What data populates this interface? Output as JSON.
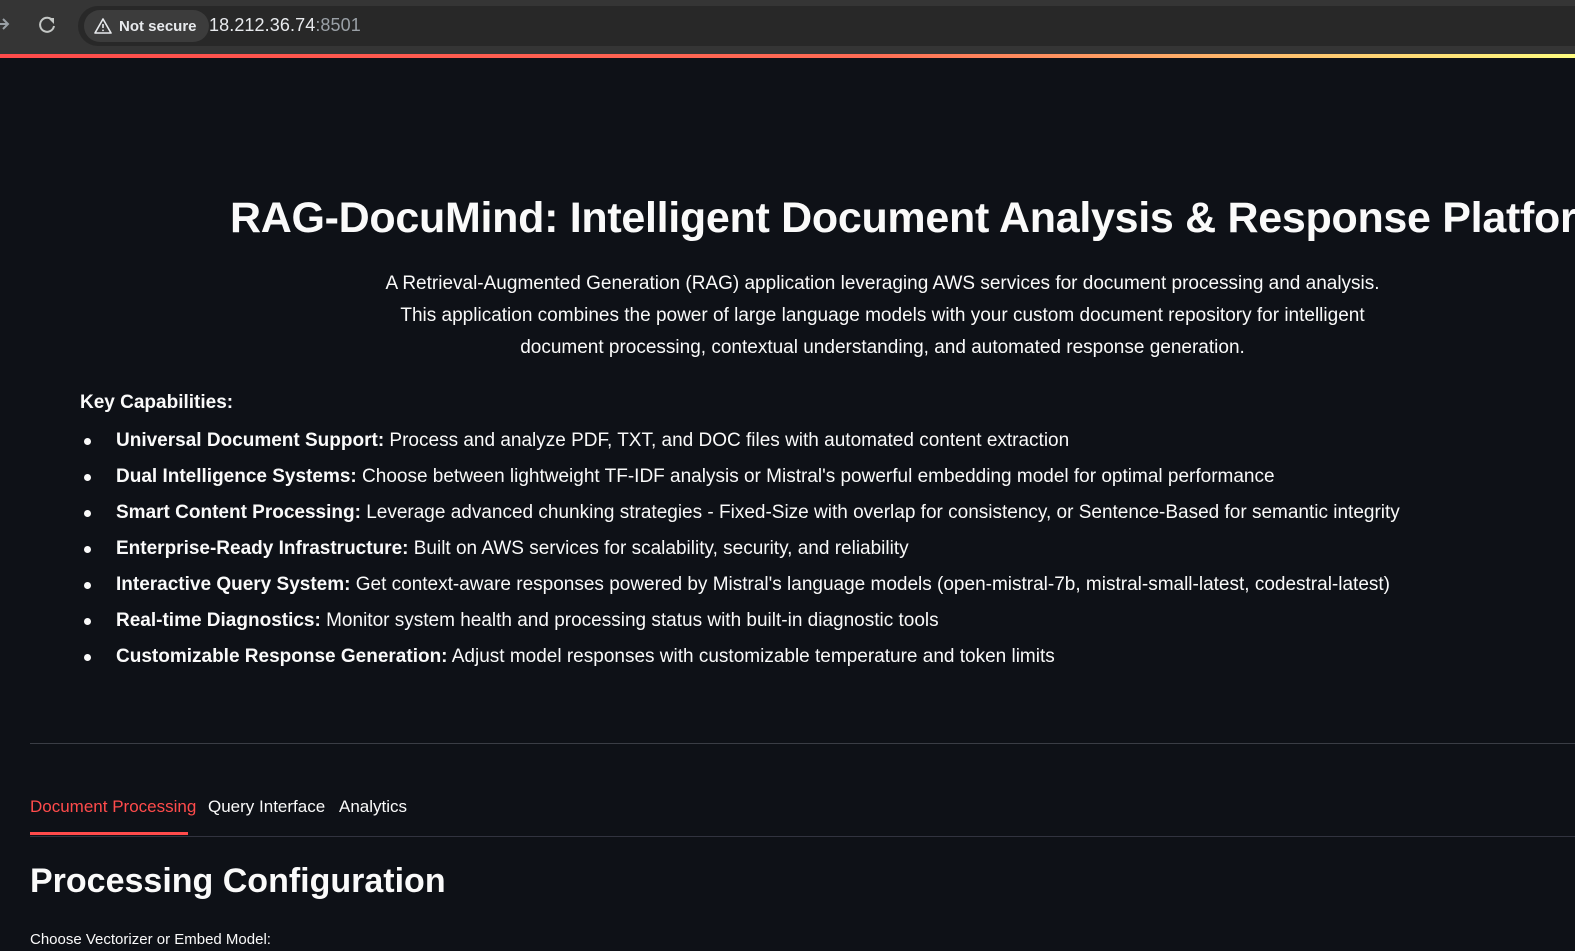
{
  "browser": {
    "security_label": "Not secure",
    "url_host": "18.212.36.74",
    "url_port": ":8501",
    "icons": {
      "forward": "arrow-right-icon",
      "reload": "reload-icon",
      "security": "warning-triangle-icon"
    }
  },
  "theme": {
    "background": "#0e1117",
    "accent": "#ff4b4b",
    "text": "#fafafa"
  },
  "header": {
    "title": "RAG-DocuMind: Intelligent Document Analysis & Response Platform",
    "intro_line1": "A Retrieval-Augmented Generation (RAG) application leveraging AWS services for document processing and analysis.",
    "intro_line2": "This application combines the power of large language models with your custom document repository for intelligent document processing, contextual understanding, and automated response generation."
  },
  "capabilities": {
    "heading": "Key Capabilities:",
    "items": [
      {
        "title": "Universal Document Support:",
        "text": " Process and analyze PDF, TXT, and DOC files with automated content extraction"
      },
      {
        "title": "Dual Intelligence Systems:",
        "text": " Choose between lightweight TF-IDF analysis or Mistral's powerful embedding model for optimal performance"
      },
      {
        "title": "Smart Content Processing:",
        "text": " Leverage advanced chunking strategies - Fixed-Size with overlap for consistency, or Sentence-Based for semantic integrity"
      },
      {
        "title": "Enterprise-Ready Infrastructure:",
        "text": " Built on AWS services for scalability, security, and reliability"
      },
      {
        "title": "Interactive Query System:",
        "text": " Get context-aware responses powered by Mistral's language models (open-mistral-7b, mistral-small-latest, codestral-latest)"
      },
      {
        "title": "Real-time Diagnostics:",
        "text": " Monitor system health and processing status with built-in diagnostic tools"
      },
      {
        "title": "Customizable Response Generation:",
        "text": " Adjust model responses with customizable temperature and token limits"
      }
    ]
  },
  "tabs": [
    {
      "label": "Document Processing",
      "active": true
    },
    {
      "label": "Query Interface",
      "active": false
    },
    {
      "label": "Analytics",
      "active": false
    }
  ],
  "main": {
    "section_title": "Processing Configuration",
    "vectorizer_label": "Choose Vectorizer or Embed Model:"
  }
}
